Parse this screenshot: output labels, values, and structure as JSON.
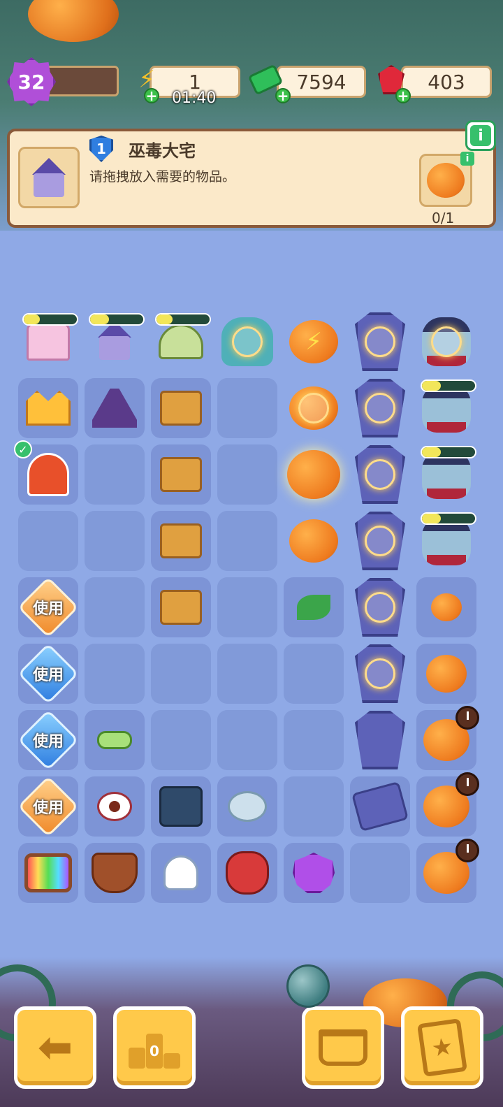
{
  "hud": {
    "level": "32",
    "energy": "1",
    "energy_timer": "01:40",
    "cash": "7594",
    "gems": "403"
  },
  "quest": {
    "level": "1",
    "title": "巫毒大宅",
    "description": "请拖拽放入需要的物品。",
    "required_count": "0/1",
    "info_label": "i"
  },
  "colors": {
    "level_badge": "#b04fd8",
    "energy": "#f2c02a",
    "cash": "#2fbf5a",
    "gem": "#e0283a",
    "board": "#8fa9e6",
    "cell": "#7d94d6",
    "button": "#ffc94a"
  },
  "tokens": {
    "use_label": "使用"
  },
  "generator_progress": {
    "pink_castle": 0.25,
    "purple_house": 0.3,
    "green_house": 0.25,
    "vampire_r1": 0.3,
    "vampire_r2": 0.3,
    "vampire_r3": 0.3
  },
  "bottom_bar": {
    "back_icon": "arrow-left-icon",
    "leaderboard_icon": "podium-icon",
    "leaderboard_value": "0",
    "shop_icon": "basket-icon",
    "tasks_icon": "clipboard-star-icon"
  }
}
